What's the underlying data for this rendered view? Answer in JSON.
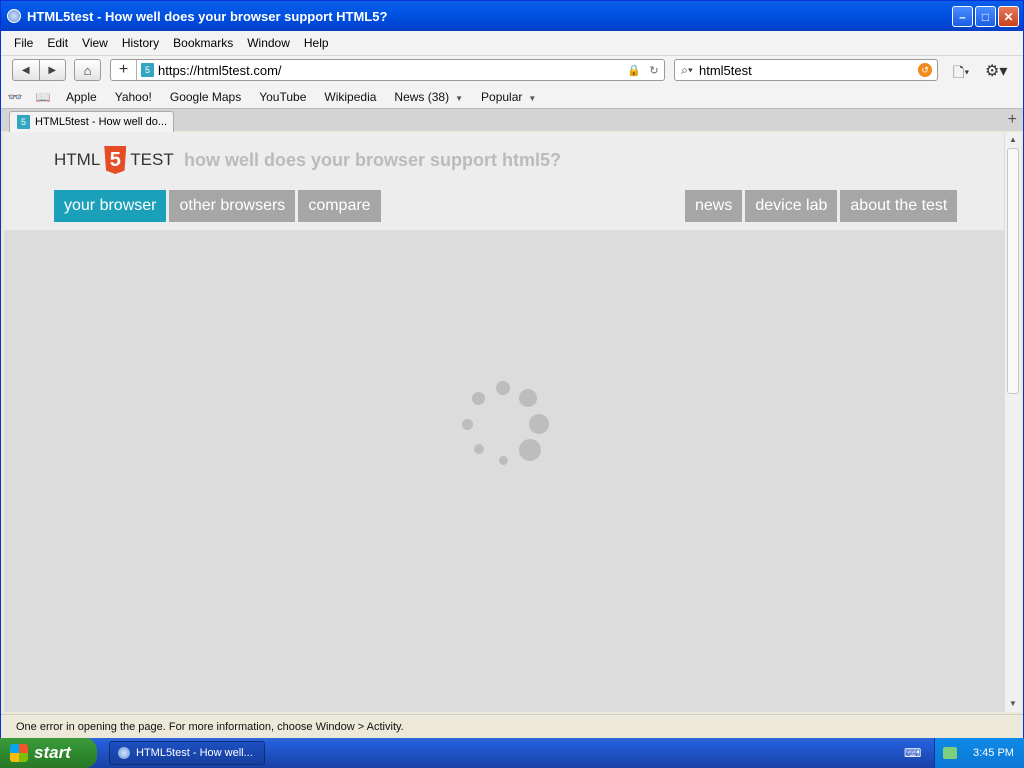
{
  "window": {
    "title": "HTML5test - How well does your browser support HTML5?",
    "controls": {
      "minimize": "–",
      "maximize": "□",
      "close": "✕"
    }
  },
  "menu": [
    "File",
    "Edit",
    "View",
    "History",
    "Bookmarks",
    "Window",
    "Help"
  ],
  "toolbar": {
    "address": "https://html5test.com/",
    "search": "html5test"
  },
  "bookmarks": {
    "items": [
      "Apple",
      "Yahoo!",
      "Google Maps",
      "YouTube",
      "Wikipedia"
    ],
    "folders": [
      "News (38)",
      "Popular"
    ]
  },
  "tab": {
    "title": "HTML5test - How well do..."
  },
  "page": {
    "logo_left": "HTML",
    "logo_badge": "5",
    "logo_right": "TEST",
    "tagline": "how well does your browser support html5?",
    "nav_left": [
      "your browser",
      "other browsers",
      "compare"
    ],
    "nav_right": [
      "news",
      "device lab",
      "about the test"
    ]
  },
  "status": "One error in opening the page. For more information, choose Window > Activity.",
  "taskbar": {
    "start": "start",
    "task": "HTML5test - How well...",
    "time": "3:45 PM"
  },
  "colors": {
    "active_nav": "#1aa0b8",
    "inactive_nav": "#a6a6a6",
    "html5_orange": "#e44d26"
  }
}
